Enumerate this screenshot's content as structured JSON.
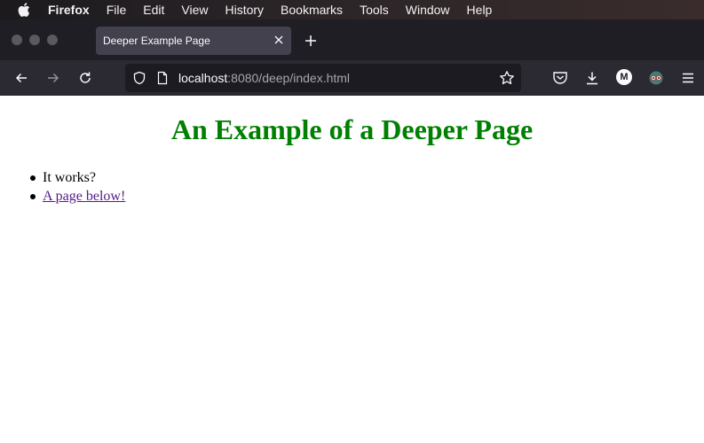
{
  "menubar": {
    "apple_icon": "apple-logo-icon",
    "app_name": "Firefox",
    "items": [
      "File",
      "Edit",
      "View",
      "History",
      "Bookmarks",
      "Tools",
      "Window",
      "Help"
    ]
  },
  "tabs": [
    {
      "title": "Deeper Example Page",
      "close_icon": "close-icon"
    }
  ],
  "toolbar": {
    "url_host": "localhost",
    "url_rest": ":8080/deep/index.html",
    "account_initial": "M",
    "icons": [
      "back-arrow-icon",
      "forward-arrow-icon",
      "reload-icon",
      "shield-icon",
      "page-icon",
      "star-icon",
      "pocket-icon",
      "download-icon",
      "account-icon",
      "extension-icon",
      "menu-icon"
    ]
  },
  "page": {
    "heading": "An Example of a Deeper Page",
    "list": [
      {
        "text": "It works?"
      },
      {
        "text": "A page below!"
      }
    ]
  },
  "colors": {
    "heading": "#008000",
    "visited_link": "#551a8b",
    "toolbar_bg": "#2b2a33",
    "tabstrip_bg": "#1f1e25"
  }
}
